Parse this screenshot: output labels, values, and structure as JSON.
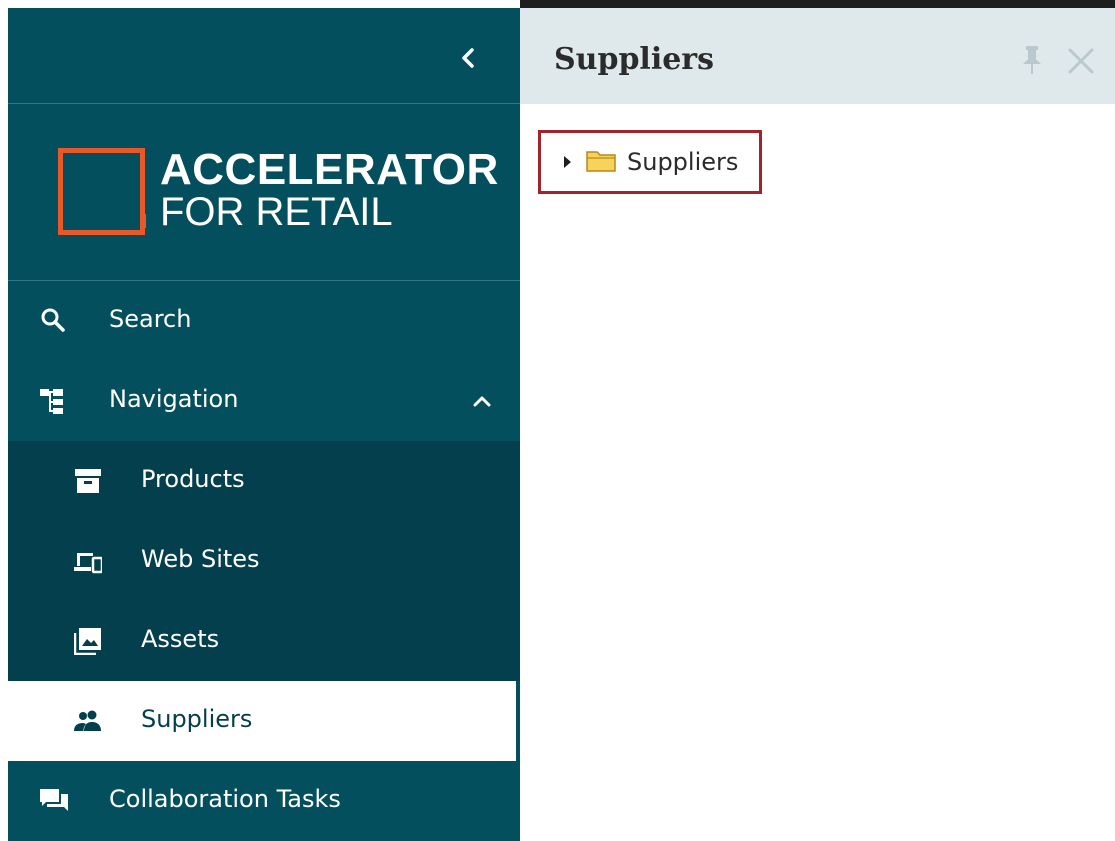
{
  "sidebar": {
    "logo": {
      "line1": "ACCELERATOR",
      "line2": "FOR RETAIL"
    },
    "items": [
      {
        "label": "Search",
        "icon": "search-icon"
      },
      {
        "label": "Navigation",
        "icon": "hierarchy-icon"
      },
      {
        "label": "Products",
        "icon": "archive-box-icon"
      },
      {
        "label": "Web Sites",
        "icon": "devices-icon"
      },
      {
        "label": "Assets",
        "icon": "image-gallery-icon"
      },
      {
        "label": "Suppliers",
        "icon": "people-icon",
        "active": true
      },
      {
        "label": "Collaboration Tasks",
        "icon": "chat-bubbles-icon"
      }
    ]
  },
  "panel": {
    "title": "Suppliers",
    "tree": [
      {
        "label": "Suppliers",
        "icon": "folder-icon",
        "expanded": false
      }
    ]
  },
  "colors": {
    "sidebar": "#034f5e",
    "sidebar_sub": "#033f4c",
    "logo_accent": "#e8592a",
    "header_bg": "#dfe9ec",
    "highlight_border": "#a3232b"
  }
}
